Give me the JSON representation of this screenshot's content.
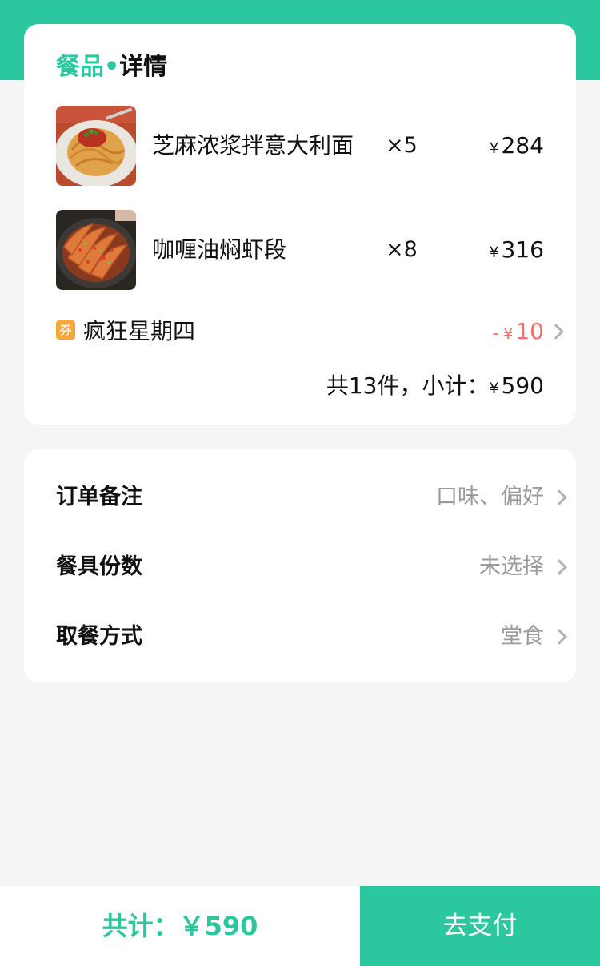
{
  "colors": {
    "accent": "#2bc79e",
    "discount": "#f76c6c",
    "coupon_badge": "#f5a83a",
    "muted": "#9a9a9a"
  },
  "detail": {
    "title_part1": "餐品",
    "title_dot": "•",
    "title_part2": "详情",
    "items": [
      {
        "name": "芝麻浓浆拌意大利面",
        "qty": "×5",
        "currency": "¥",
        "price": "284",
        "image": "spaghetti-photo"
      },
      {
        "name": "咖喱油焖虾段",
        "qty": "×8",
        "currency": "¥",
        "price": "316",
        "image": "braised-shrimp-photo"
      }
    ],
    "coupon": {
      "badge": "券",
      "name": "疯狂星期四",
      "minus": "-",
      "currency": "¥",
      "amount": "10"
    },
    "subtotal": {
      "label": "共13件，小计：",
      "currency": "¥",
      "amount": "590"
    }
  },
  "options": [
    {
      "label": "订单备注",
      "value": "口味、偏好"
    },
    {
      "label": "餐具份数",
      "value": "未选择"
    },
    {
      "label": "取餐方式",
      "value": "堂食"
    }
  ],
  "footer": {
    "total_label": "共计：",
    "total_value": "￥590",
    "pay_label": "去支付"
  }
}
